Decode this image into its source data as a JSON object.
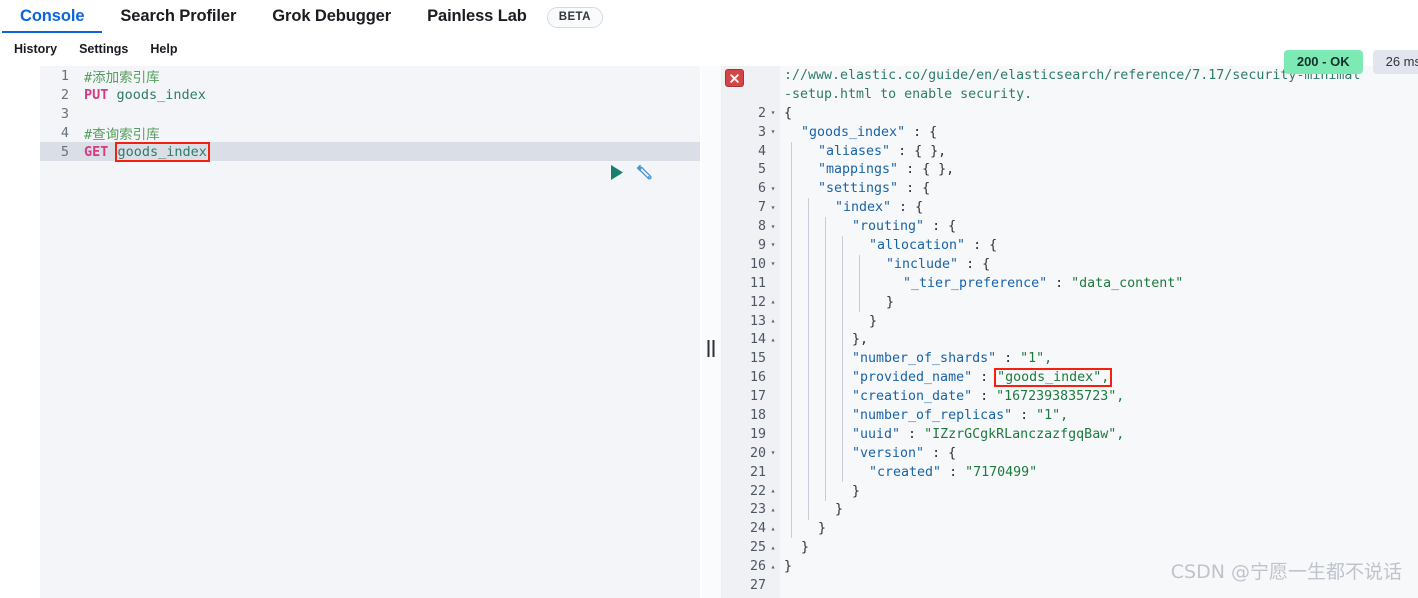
{
  "header": {
    "tabs": [
      {
        "label": "Console",
        "active": true
      },
      {
        "label": "Search Profiler",
        "active": false
      },
      {
        "label": "Grok Debugger",
        "active": false
      },
      {
        "label": "Painless Lab",
        "active": false
      }
    ],
    "beta_badge": "BETA",
    "accent_color": "#0b64dd"
  },
  "subnav": {
    "items": [
      {
        "label": "History"
      },
      {
        "label": "Settings"
      },
      {
        "label": "Help"
      }
    ]
  },
  "status": {
    "code": "200 - OK",
    "code_color": "#7deab5",
    "time": "26 ms"
  },
  "editor": {
    "lines": [
      {
        "num": "1",
        "segments": [
          {
            "text": "#添加索引库",
            "cls": "tok-comment"
          }
        ]
      },
      {
        "num": "2",
        "segments": [
          {
            "text": "PUT",
            "cls": "tok-method"
          },
          {
            "text": " ",
            "cls": ""
          },
          {
            "text": "goods_index",
            "cls": "tok-url"
          }
        ]
      },
      {
        "num": "3",
        "segments": []
      },
      {
        "num": "4",
        "segments": [
          {
            "text": "#查询索引库",
            "cls": "tok-comment"
          }
        ]
      },
      {
        "num": "5",
        "active": true,
        "segments": [
          {
            "text": "GET",
            "cls": "tok-method"
          },
          {
            "text": " ",
            "cls": ""
          },
          {
            "text": "goods_index",
            "cls": "tok-url redbox"
          }
        ]
      }
    ],
    "run_icon": "play-icon",
    "wrench_icon": "wrench-icon"
  },
  "response": {
    "warning_tail_visible": true,
    "lines": [
      {
        "num": "",
        "fold": "",
        "indent": 0,
        "text": "://www.elastic.co/guide/en/elasticsearch/reference/7.17/security-minimal",
        "cls": "jwarn"
      },
      {
        "num": "",
        "fold": "",
        "indent": 0,
        "text": "-setup.html to enable security.",
        "cls": "jwarn"
      },
      {
        "num": "2",
        "fold": "▾",
        "indent": 0,
        "text": "{",
        "cls": "jpunct"
      },
      {
        "num": "3",
        "fold": "▾",
        "indent": 1,
        "key": "\"goods_index\"",
        "sep": " : ",
        "val": "{",
        "valcls": "jpunct"
      },
      {
        "num": "4",
        "fold": "",
        "indent": 2,
        "key": "\"aliases\"",
        "sep": " : ",
        "val": "{ },",
        "valcls": "jpunct"
      },
      {
        "num": "5",
        "fold": "",
        "indent": 2,
        "key": "\"mappings\"",
        "sep": " : ",
        "val": "{ },",
        "valcls": "jpunct"
      },
      {
        "num": "6",
        "fold": "▾",
        "indent": 2,
        "key": "\"settings\"",
        "sep": " : ",
        "val": "{",
        "valcls": "jpunct"
      },
      {
        "num": "7",
        "fold": "▾",
        "indent": 3,
        "key": "\"index\"",
        "sep": " : ",
        "val": "{",
        "valcls": "jpunct"
      },
      {
        "num": "8",
        "fold": "▾",
        "indent": 4,
        "key": "\"routing\"",
        "sep": " : ",
        "val": "{",
        "valcls": "jpunct"
      },
      {
        "num": "9",
        "fold": "▾",
        "indent": 5,
        "key": "\"allocation\"",
        "sep": " : ",
        "val": "{",
        "valcls": "jpunct"
      },
      {
        "num": "10",
        "fold": "▾",
        "indent": 6,
        "key": "\"include\"",
        "sep": " : ",
        "val": "{",
        "valcls": "jpunct"
      },
      {
        "num": "11",
        "fold": "",
        "indent": 7,
        "key": "\"_tier_preference\"",
        "sep": " : ",
        "val": "\"data_content\"",
        "valcls": "jstr"
      },
      {
        "num": "12",
        "fold": "▴",
        "indent": 6,
        "text": "}",
        "cls": "jpunct"
      },
      {
        "num": "13",
        "fold": "▴",
        "indent": 5,
        "text": "}",
        "cls": "jpunct"
      },
      {
        "num": "14",
        "fold": "▴",
        "indent": 4,
        "text": "},",
        "cls": "jpunct"
      },
      {
        "num": "15",
        "fold": "",
        "indent": 4,
        "key": "\"number_of_shards\"",
        "sep": " : ",
        "val": "\"1\",",
        "valcls": "jstr"
      },
      {
        "num": "16",
        "fold": "",
        "indent": 4,
        "key": "\"provided_name\"",
        "sep": " : ",
        "val": "\"goods_index\",",
        "valcls": "jstr",
        "highlight": true
      },
      {
        "num": "17",
        "fold": "",
        "indent": 4,
        "key": "\"creation_date\"",
        "sep": " : ",
        "val": "\"1672393835723\",",
        "valcls": "jstr"
      },
      {
        "num": "18",
        "fold": "",
        "indent": 4,
        "key": "\"number_of_replicas\"",
        "sep": " : ",
        "val": "\"1\",",
        "valcls": "jstr"
      },
      {
        "num": "19",
        "fold": "",
        "indent": 4,
        "key": "\"uuid\"",
        "sep": " : ",
        "val": "\"IZzrGCgkRLanczazfgqBaw\",",
        "valcls": "jstr"
      },
      {
        "num": "20",
        "fold": "▾",
        "indent": 4,
        "key": "\"version\"",
        "sep": " : ",
        "val": "{",
        "valcls": "jpunct"
      },
      {
        "num": "21",
        "fold": "",
        "indent": 5,
        "key": "\"created\"",
        "sep": " : ",
        "val": "\"7170499\"",
        "valcls": "jstr"
      },
      {
        "num": "22",
        "fold": "▴",
        "indent": 4,
        "text": "}",
        "cls": "jpunct"
      },
      {
        "num": "23",
        "fold": "▴",
        "indent": 3,
        "text": "}",
        "cls": "jpunct"
      },
      {
        "num": "24",
        "fold": "▴",
        "indent": 2,
        "text": "}",
        "cls": "jpunct"
      },
      {
        "num": "25",
        "fold": "▴",
        "indent": 1,
        "text": "}",
        "cls": "jpunct"
      },
      {
        "num": "26",
        "fold": "▴",
        "indent": 0,
        "text": "}",
        "cls": "jpunct"
      },
      {
        "num": "27",
        "fold": "",
        "indent": 0,
        "text": "",
        "cls": "jpunct"
      }
    ],
    "error_marker_icon": "error-x-icon"
  },
  "watermark": "CSDN @宁愿一生都不说话"
}
